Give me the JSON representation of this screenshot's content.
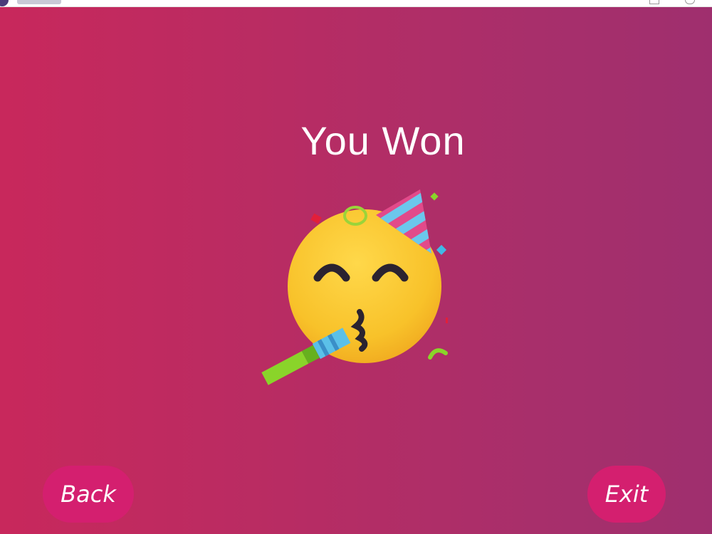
{
  "screen": {
    "title": "You Won",
    "emoji_icon": "partying-face-icon"
  },
  "buttons": {
    "back_label": "Back",
    "exit_label": "Exit"
  },
  "colors": {
    "background_left": "#c8285c",
    "background_right": "#9f2f6e",
    "button": "#d41f6f",
    "text": "#ffffff",
    "emoji_face": "#f8c52b"
  }
}
